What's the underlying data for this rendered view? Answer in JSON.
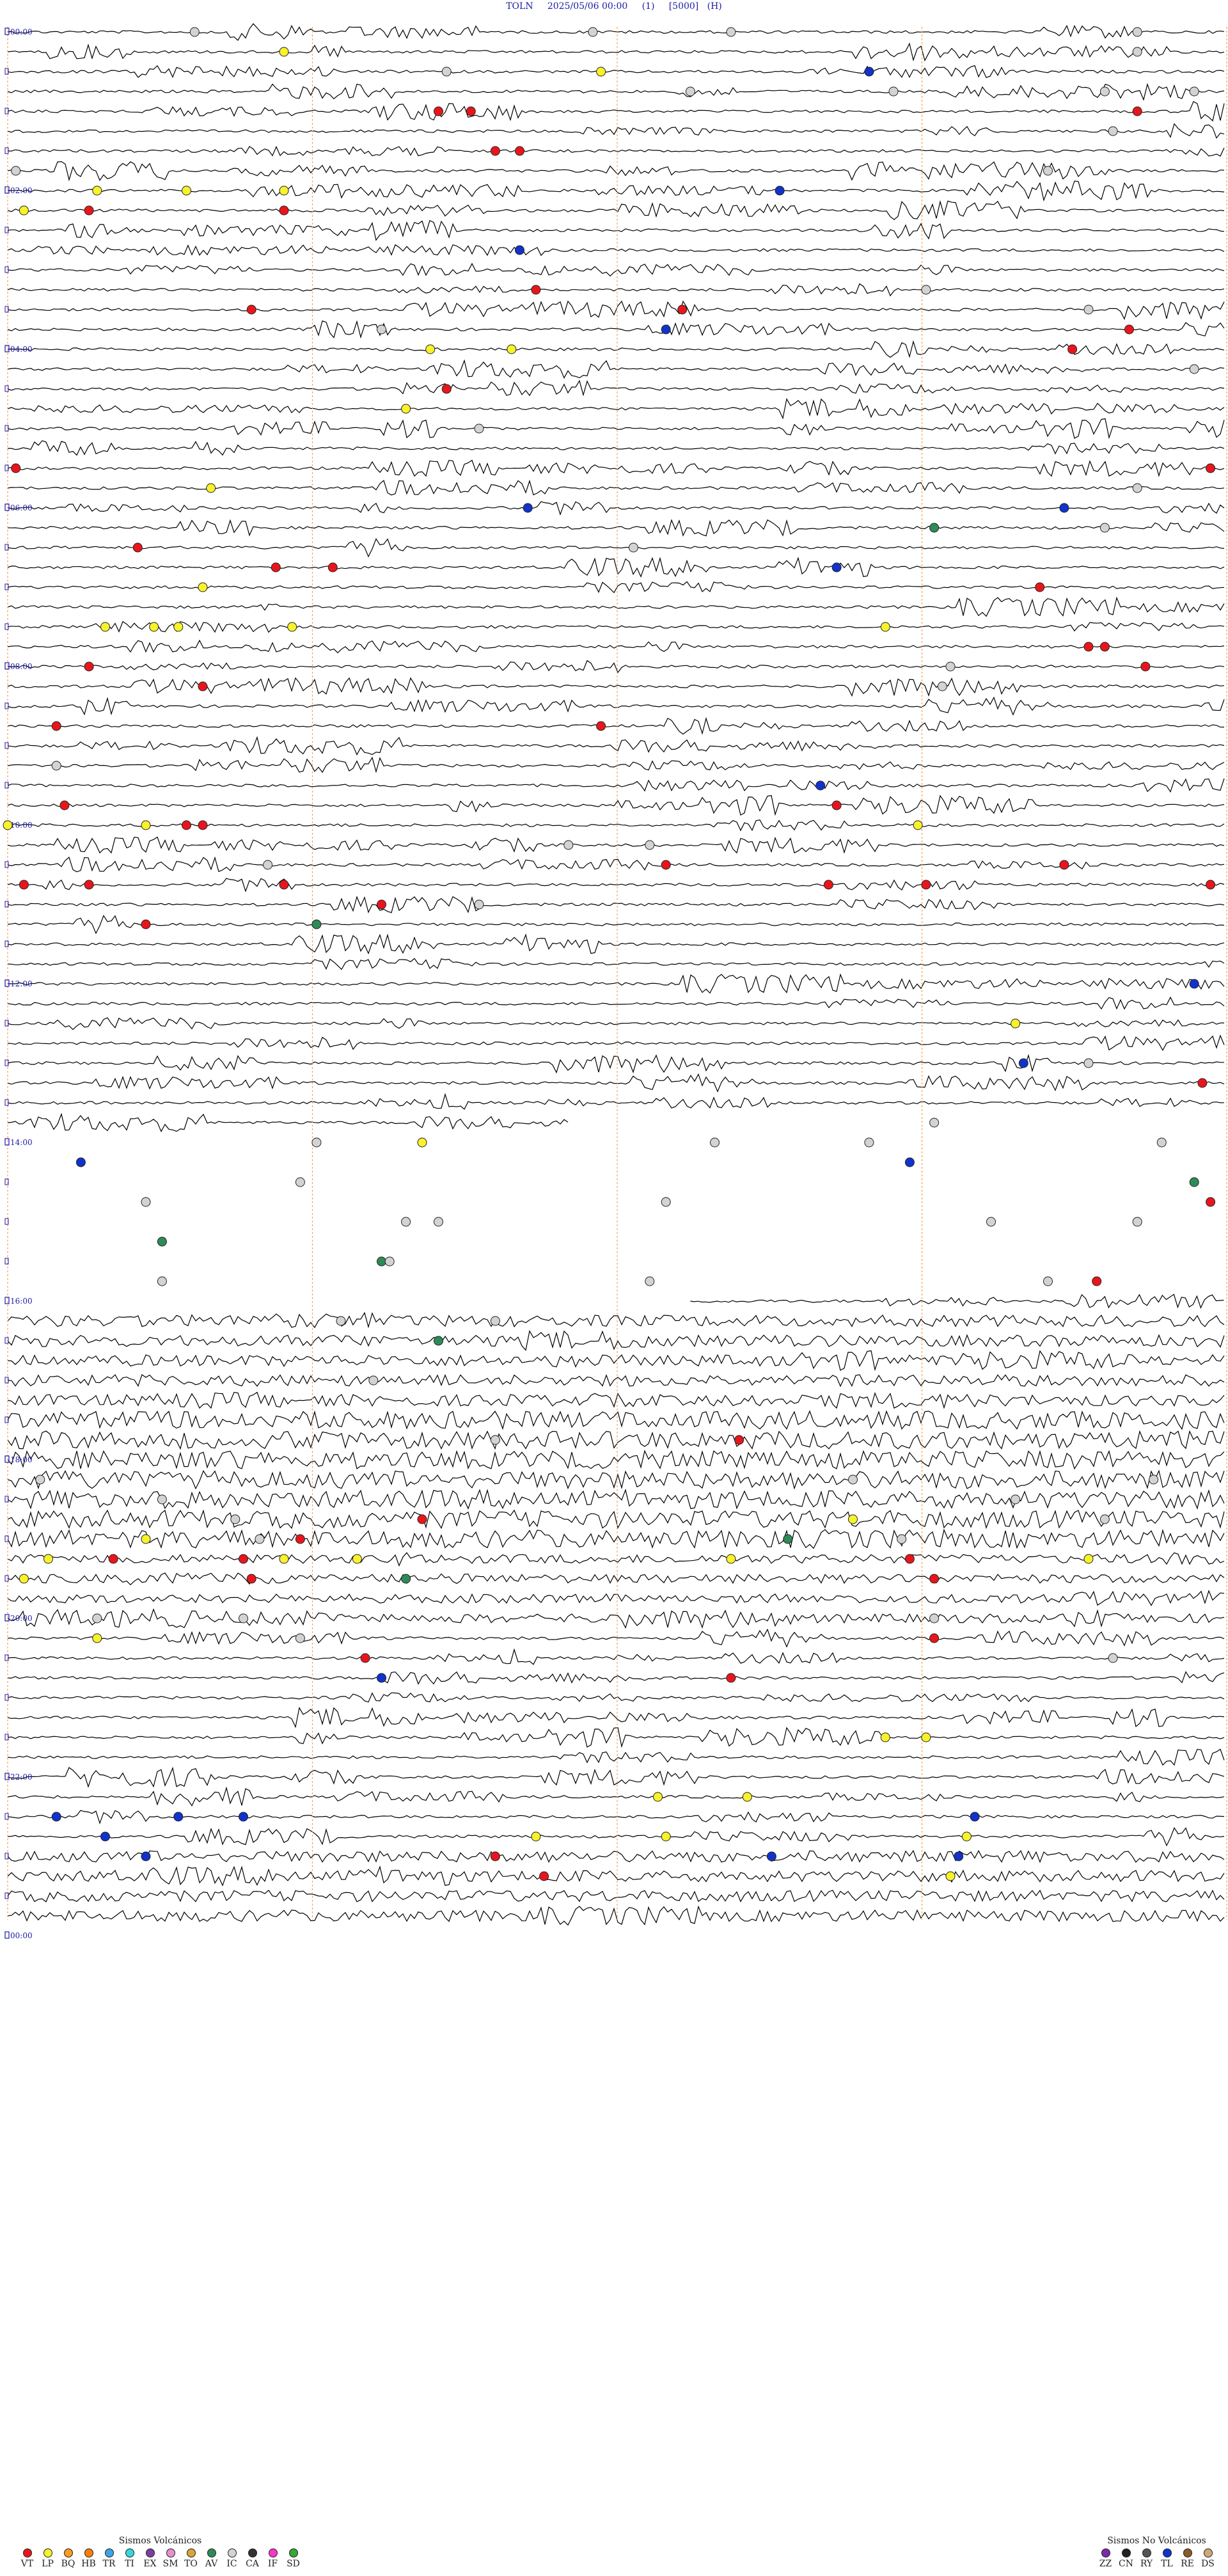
{
  "header": {
    "station": "TOLN",
    "datetime": "2025/05/06 00:00",
    "channel": "(1)",
    "scale": "[5000]",
    "unit": "(H)"
  },
  "chart_data": {
    "type": "helicorder",
    "rows": 96,
    "row_minutes": 15,
    "hour_labels": [
      "00:00",
      "02:00",
      "04:00",
      "06:00",
      "08:00",
      "10:00",
      "12:00",
      "14:00",
      "16:00",
      "18:00",
      "20:00",
      "22:00",
      "00:00"
    ],
    "gap_rows": [
      55,
      64
    ],
    "event_markers": [
      {
        "row": 0,
        "minute": 2.3,
        "class": "IC"
      },
      {
        "row": 0,
        "minute": 7.2,
        "class": "IC"
      },
      {
        "row": 0,
        "minute": 8.9,
        "class": "IC"
      },
      {
        "row": 0,
        "minute": 13.9,
        "class": "IC"
      },
      {
        "row": 1,
        "minute": 3.4,
        "class": "LP"
      },
      {
        "row": 1,
        "minute": 13.9,
        "class": "IC"
      },
      {
        "row": 2,
        "minute": 5.4,
        "class": "IC"
      },
      {
        "row": 2,
        "minute": 7.3,
        "class": "LP"
      },
      {
        "row": 2,
        "minute": 10.6,
        "class": "TL"
      },
      {
        "row": 3,
        "minute": 8.4,
        "class": "IC"
      },
      {
        "row": 3,
        "minute": 10.9,
        "class": "IC"
      },
      {
        "row": 3,
        "minute": 13.5,
        "class": "IC"
      },
      {
        "row": 3,
        "minute": 14.6,
        "class": "IC"
      },
      {
        "row": 4,
        "minute": 5.3,
        "class": "VT"
      },
      {
        "row": 4,
        "minute": 5.7,
        "class": "VT"
      },
      {
        "row": 4,
        "minute": 13.9,
        "class": "VT"
      },
      {
        "row": 5,
        "minute": 13.6,
        "class": "IC"
      },
      {
        "row": 6,
        "minute": 6.0,
        "class": "VT"
      },
      {
        "row": 6,
        "minute": 6.3,
        "class": "VT"
      },
      {
        "row": 7,
        "minute": 0.1,
        "class": "IC"
      },
      {
        "row": 7,
        "minute": 12.8,
        "class": "IC"
      },
      {
        "row": 8,
        "minute": 1.1,
        "class": "LP"
      },
      {
        "row": 8,
        "minute": 2.2,
        "class": "LP"
      },
      {
        "row": 8,
        "minute": 3.4,
        "class": "LP"
      },
      {
        "row": 8,
        "minute": 9.5,
        "class": "TL"
      },
      {
        "row": 9,
        "minute": 0.2,
        "class": "LP"
      },
      {
        "row": 9,
        "minute": 1.0,
        "class": "VT"
      },
      {
        "row": 9,
        "minute": 3.4,
        "class": "VT"
      },
      {
        "row": 11,
        "minute": 6.3,
        "class": "TL"
      },
      {
        "row": 13,
        "minute": 6.5,
        "class": "VT"
      },
      {
        "row": 13,
        "minute": 11.3,
        "class": "IC"
      },
      {
        "row": 14,
        "minute": 3.0,
        "class": "VT"
      },
      {
        "row": 14,
        "minute": 8.3,
        "class": "VT"
      },
      {
        "row": 14,
        "minute": 13.3,
        "class": "IC"
      },
      {
        "row": 15,
        "minute": 4.6,
        "class": "IC"
      },
      {
        "row": 15,
        "minute": 8.1,
        "class": "TL"
      },
      {
        "row": 15,
        "minute": 13.8,
        "class": "VT"
      },
      {
        "row": 16,
        "minute": 5.2,
        "class": "LP"
      },
      {
        "row": 16,
        "minute": 6.2,
        "class": "LP"
      },
      {
        "row": 16,
        "minute": 13.1,
        "class": "VT"
      },
      {
        "row": 17,
        "minute": 14.6,
        "class": "IC"
      },
      {
        "row": 18,
        "minute": 5.4,
        "class": "VT"
      },
      {
        "row": 19,
        "minute": 4.9,
        "class": "LP"
      },
      {
        "row": 20,
        "minute": 5.8,
        "class": "IC"
      },
      {
        "row": 22,
        "minute": 0.1,
        "class": "VT"
      },
      {
        "row": 22,
        "minute": 14.8,
        "class": "VT"
      },
      {
        "row": 23,
        "minute": 2.5,
        "class": "LP"
      },
      {
        "row": 23,
        "minute": 13.9,
        "class": "IC"
      },
      {
        "row": 24,
        "minute": 6.4,
        "class": "TL"
      },
      {
        "row": 24,
        "minute": 13.0,
        "class": "TL"
      },
      {
        "row": 25,
        "minute": 11.4,
        "class": "AV"
      },
      {
        "row": 25,
        "minute": 13.5,
        "class": "IC"
      },
      {
        "row": 26,
        "minute": 1.6,
        "class": "VT"
      },
      {
        "row": 26,
        "minute": 7.7,
        "class": "IC"
      },
      {
        "row": 27,
        "minute": 3.3,
        "class": "VT"
      },
      {
        "row": 27,
        "minute": 4.0,
        "class": "VT"
      },
      {
        "row": 27,
        "minute": 10.2,
        "class": "TL"
      },
      {
        "row": 28,
        "minute": 2.4,
        "class": "LP"
      },
      {
        "row": 28,
        "minute": 12.7,
        "class": "VT"
      },
      {
        "row": 30,
        "minute": 1.2,
        "class": "LP"
      },
      {
        "row": 30,
        "minute": 1.8,
        "class": "LP"
      },
      {
        "row": 30,
        "minute": 2.1,
        "class": "LP"
      },
      {
        "row": 30,
        "minute": 3.5,
        "class": "LP"
      },
      {
        "row": 30,
        "minute": 10.8,
        "class": "LP"
      },
      {
        "row": 31,
        "minute": 13.3,
        "class": "VT"
      },
      {
        "row": 31,
        "minute": 13.5,
        "class": "VT"
      },
      {
        "row": 32,
        "minute": 1.0,
        "class": "VT"
      },
      {
        "row": 32,
        "minute": 11.6,
        "class": "IC"
      },
      {
        "row": 32,
        "minute": 14.0,
        "class": "VT"
      },
      {
        "row": 33,
        "minute": 2.4,
        "class": "VT"
      },
      {
        "row": 33,
        "minute": 11.5,
        "class": "IC"
      },
      {
        "row": 35,
        "minute": 0.6,
        "class": "VT"
      },
      {
        "row": 35,
        "minute": 7.3,
        "class": "VT"
      },
      {
        "row": 37,
        "minute": 0.6,
        "class": "IC"
      },
      {
        "row": 38,
        "minute": 10.0,
        "class": "TL"
      },
      {
        "row": 39,
        "minute": 0.7,
        "class": "VT"
      },
      {
        "row": 39,
        "minute": 10.2,
        "class": "VT"
      },
      {
        "row": 40,
        "minute": 0.0,
        "class": "LP"
      },
      {
        "row": 40,
        "minute": 1.7,
        "class": "LP"
      },
      {
        "row": 40,
        "minute": 2.2,
        "class": "VT"
      },
      {
        "row": 40,
        "minute": 2.4,
        "class": "VT"
      },
      {
        "row": 40,
        "minute": 11.2,
        "class": "LP"
      },
      {
        "row": 41,
        "minute": 6.9,
        "class": "IC"
      },
      {
        "row": 41,
        "minute": 7.9,
        "class": "IC"
      },
      {
        "row": 42,
        "minute": 3.2,
        "class": "IC"
      },
      {
        "row": 42,
        "minute": 8.1,
        "class": "VT"
      },
      {
        "row": 42,
        "minute": 13.0,
        "class": "VT"
      },
      {
        "row": 43,
        "minute": 0.2,
        "class": "VT"
      },
      {
        "row": 43,
        "minute": 1.0,
        "class": "VT"
      },
      {
        "row": 43,
        "minute": 3.4,
        "class": "VT"
      },
      {
        "row": 43,
        "minute": 10.1,
        "class": "VT"
      },
      {
        "row": 43,
        "minute": 11.3,
        "class": "VT"
      },
      {
        "row": 43,
        "minute": 14.8,
        "class": "VT"
      },
      {
        "row": 44,
        "minute": 4.6,
        "class": "VT"
      },
      {
        "row": 44,
        "minute": 5.8,
        "class": "IC"
      },
      {
        "row": 45,
        "minute": 1.7,
        "class": "VT"
      },
      {
        "row": 45,
        "minute": 3.8,
        "class": "AV"
      },
      {
        "row": 48,
        "minute": 14.6,
        "class": "TL"
      },
      {
        "row": 50,
        "minute": 12.4,
        "class": "LP"
      },
      {
        "row": 52,
        "minute": 12.5,
        "class": "TL"
      },
      {
        "row": 52,
        "minute": 13.3,
        "class": "IC"
      },
      {
        "row": 53,
        "minute": 14.7,
        "class": "VT"
      },
      {
        "row": 55,
        "minute": 11.4,
        "class": "IC"
      },
      {
        "row": 56,
        "minute": 3.8,
        "class": "IC"
      },
      {
        "row": 56,
        "minute": 5.1,
        "class": "LP"
      },
      {
        "row": 56,
        "minute": 8.7,
        "class": "IC"
      },
      {
        "row": 56,
        "minute": 10.6,
        "class": "IC"
      },
      {
        "row": 56,
        "minute": 14.2,
        "class": "IC"
      },
      {
        "row": 57,
        "minute": 0.9,
        "class": "TL"
      },
      {
        "row": 57,
        "minute": 11.1,
        "class": "TL"
      },
      {
        "row": 58,
        "minute": 3.6,
        "class": "IC"
      },
      {
        "row": 58,
        "minute": 14.6,
        "class": "AV"
      },
      {
        "row": 59,
        "minute": 1.7,
        "class": "IC"
      },
      {
        "row": 59,
        "minute": 8.1,
        "class": "IC"
      },
      {
        "row": 59,
        "minute": 14.8,
        "class": "VT"
      },
      {
        "row": 60,
        "minute": 4.9,
        "class": "IC"
      },
      {
        "row": 60,
        "minute": 5.3,
        "class": "IC"
      },
      {
        "row": 60,
        "minute": 12.1,
        "class": "IC"
      },
      {
        "row": 60,
        "minute": 13.9,
        "class": "IC"
      },
      {
        "row": 61,
        "minute": 1.9,
        "class": "AV"
      },
      {
        "row": 62,
        "minute": 4.6,
        "class": "AV"
      },
      {
        "row": 62,
        "minute": 4.7,
        "class": "IC"
      },
      {
        "row": 63,
        "minute": 1.9,
        "class": "IC"
      },
      {
        "row": 63,
        "minute": 7.9,
        "class": "IC"
      },
      {
        "row": 63,
        "minute": 12.8,
        "class": "IC"
      },
      {
        "row": 63,
        "minute": 13.4,
        "class": "VT"
      },
      {
        "row": 65,
        "minute": 4.1,
        "class": "IC"
      },
      {
        "row": 65,
        "minute": 6.0,
        "class": "IC"
      },
      {
        "row": 66,
        "minute": 5.3,
        "class": "AV"
      },
      {
        "row": 68,
        "minute": 4.5,
        "class": "IC"
      },
      {
        "row": 71,
        "minute": 6.0,
        "class": "IC"
      },
      {
        "row": 71,
        "minute": 9.0,
        "class": "VT"
      },
      {
        "row": 73,
        "minute": 0.4,
        "class": "IC"
      },
      {
        "row": 73,
        "minute": 10.4,
        "class": "IC"
      },
      {
        "row": 73,
        "minute": 14.1,
        "class": "IC"
      },
      {
        "row": 74,
        "minute": 1.9,
        "class": "IC"
      },
      {
        "row": 74,
        "minute": 12.4,
        "class": "IC"
      },
      {
        "row": 75,
        "minute": 2.8,
        "class": "IC"
      },
      {
        "row": 75,
        "minute": 5.1,
        "class": "VT"
      },
      {
        "row": 75,
        "minute": 10.4,
        "class": "LP"
      },
      {
        "row": 75,
        "minute": 13.5,
        "class": "IC"
      },
      {
        "row": 76,
        "minute": 1.7,
        "class": "LP"
      },
      {
        "row": 76,
        "minute": 3.1,
        "class": "IC"
      },
      {
        "row": 76,
        "minute": 3.6,
        "class": "VT"
      },
      {
        "row": 76,
        "minute": 9.6,
        "class": "AV"
      },
      {
        "row": 76,
        "minute": 11.0,
        "class": "IC"
      },
      {
        "row": 77,
        "minute": 0.5,
        "class": "LP"
      },
      {
        "row": 77,
        "minute": 1.3,
        "class": "VT"
      },
      {
        "row": 77,
        "minute": 2.9,
        "class": "VT"
      },
      {
        "row": 77,
        "minute": 3.4,
        "class": "LP"
      },
      {
        "row": 77,
        "minute": 4.3,
        "class": "LP"
      },
      {
        "row": 77,
        "minute": 8.9,
        "class": "LP"
      },
      {
        "row": 77,
        "minute": 11.1,
        "class": "VT"
      },
      {
        "row": 77,
        "minute": 13.3,
        "class": "LP"
      },
      {
        "row": 78,
        "minute": 0.2,
        "class": "LP"
      },
      {
        "row": 78,
        "minute": 3.0,
        "class": "VT"
      },
      {
        "row": 78,
        "minute": 4.9,
        "class": "AV"
      },
      {
        "row": 78,
        "minute": 11.4,
        "class": "VT"
      },
      {
        "row": 80,
        "minute": 1.1,
        "class": "IC"
      },
      {
        "row": 80,
        "minute": 2.9,
        "class": "IC"
      },
      {
        "row": 80,
        "minute": 11.4,
        "class": "IC"
      },
      {
        "row": 81,
        "minute": 1.1,
        "class": "LP"
      },
      {
        "row": 81,
        "minute": 3.6,
        "class": "IC"
      },
      {
        "row": 81,
        "minute": 11.4,
        "class": "VT"
      },
      {
        "row": 82,
        "minute": 4.4,
        "class": "VT"
      },
      {
        "row": 82,
        "minute": 13.6,
        "class": "IC"
      },
      {
        "row": 83,
        "minute": 4.6,
        "class": "TL"
      },
      {
        "row": 83,
        "minute": 8.9,
        "class": "VT"
      },
      {
        "row": 86,
        "minute": 10.8,
        "class": "LP"
      },
      {
        "row": 86,
        "minute": 11.3,
        "class": "LP"
      },
      {
        "row": 89,
        "minute": 8.0,
        "class": "LP"
      },
      {
        "row": 89,
        "minute": 9.1,
        "class": "LP"
      },
      {
        "row": 90,
        "minute": 0.6,
        "class": "TL"
      },
      {
        "row": 90,
        "minute": 2.1,
        "class": "TL"
      },
      {
        "row": 90,
        "minute": 2.9,
        "class": "TL"
      },
      {
        "row": 90,
        "minute": 11.9,
        "class": "TL"
      },
      {
        "row": 91,
        "minute": 1.2,
        "class": "TL"
      },
      {
        "row": 91,
        "minute": 6.5,
        "class": "LP"
      },
      {
        "row": 91,
        "minute": 8.1,
        "class": "LP"
      },
      {
        "row": 91,
        "minute": 11.8,
        "class": "LP"
      },
      {
        "row": 92,
        "minute": 1.7,
        "class": "TL"
      },
      {
        "row": 92,
        "minute": 6.0,
        "class": "VT"
      },
      {
        "row": 92,
        "minute": 9.4,
        "class": "TL"
      },
      {
        "row": 92,
        "minute": 11.7,
        "class": "TL"
      },
      {
        "row": 93,
        "minute": 6.6,
        "class": "VT"
      },
      {
        "row": 93,
        "minute": 11.6,
        "class": "LP"
      }
    ]
  },
  "legend": {
    "volcanic": {
      "title": "Sismos Volcánicos",
      "items": [
        {
          "code": "VT",
          "color": "#e8161c"
        },
        {
          "code": "LP",
          "color": "#f7f22a"
        },
        {
          "code": "BQ",
          "color": "#ff9a1e"
        },
        {
          "code": "HB",
          "color": "#ff7f00"
        },
        {
          "code": "TR",
          "color": "#3ca4e6"
        },
        {
          "code": "TI",
          "color": "#36d6de"
        },
        {
          "code": "EX",
          "color": "#7b3fa0"
        },
        {
          "code": "SM",
          "color": "#e78fd0"
        },
        {
          "code": "TO",
          "color": "#d9a53a"
        },
        {
          "code": "AV",
          "color": "#2e8b57"
        },
        {
          "code": "IC",
          "color": "#d3d3d3"
        },
        {
          "code": "CA",
          "color": "#333333"
        },
        {
          "code": "IF",
          "color": "#ff33cc"
        },
        {
          "code": "SD",
          "color": "#33aa33"
        }
      ]
    },
    "non_volcanic": {
      "title": "Sismos No Volcánicos",
      "items": [
        {
          "code": "ZZ",
          "color": "#7a2aa8"
        },
        {
          "code": "CN",
          "color": "#222222"
        },
        {
          "code": "RY",
          "color": "#555555"
        },
        {
          "code": "TL",
          "color": "#1133cc"
        },
        {
          "code": "RE",
          "color": "#8b5a2b"
        },
        {
          "code": "DS",
          "color": "#d2a679"
        }
      ]
    }
  }
}
